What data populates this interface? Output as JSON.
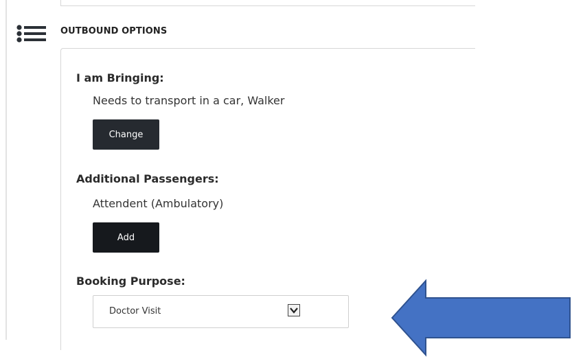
{
  "section": {
    "title": "OUTBOUND OPTIONS",
    "icon": "list-icon"
  },
  "bringing": {
    "label": "I am Bringing:",
    "value": "Needs to transport in a car, Walker",
    "button_label": "Change"
  },
  "passengers": {
    "label": "Additional Passengers:",
    "value": "Attendent (Ambulatory)",
    "button_label": "Add"
  },
  "purpose": {
    "label": "Booking Purpose:",
    "selected": "Doctor Visit",
    "arrow_icon": "chevron-down-icon"
  },
  "colors": {
    "button_dark": "#262a30",
    "callout_arrow": "#4472c4",
    "callout_arrow_border": "#2f528f"
  }
}
